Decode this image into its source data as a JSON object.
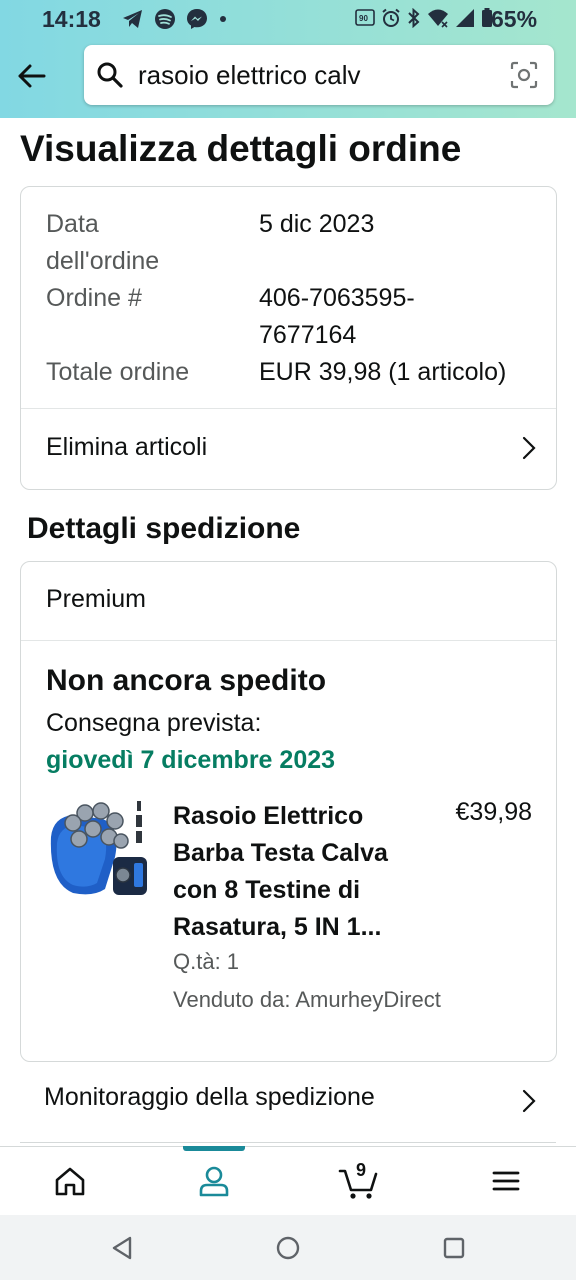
{
  "status_bar": {
    "time": "14:18",
    "battery": "65%",
    "left_icons": [
      "telegram-icon",
      "spotify-icon",
      "messenger-icon",
      "dot-icon"
    ],
    "right_icons": [
      "hd-voice-icon",
      "alarm-icon",
      "bluetooth-icon",
      "wifi-icon",
      "signal-icon",
      "battery-icon"
    ]
  },
  "search": {
    "query": "rasoio elettrico calv"
  },
  "page_title": "Visualizza dettagli ordine",
  "order_summary": {
    "date_label_line1": "Data",
    "date_label_line2": "dell'ordine",
    "date_value": "5 dic 2023",
    "order_label": "Ordine #",
    "order_value_line1": "406-7063595-",
    "order_value_line2": "7677164",
    "total_label": "Totale ordine",
    "total_value": "EUR 39,98 (1 articolo)",
    "delete_items_label": "Elimina articoli"
  },
  "shipping": {
    "section_title": "Dettagli spedizione",
    "shipping_type": "Premium",
    "status": "Non ancora spedito",
    "delivery_label": "Consegna prevista:",
    "delivery_date": "giovedì 7 dicembre 2023",
    "product": {
      "name": "Rasoio Elettrico Barba Testa Calva con 8 Testine di Rasatura, 5 IN 1...",
      "price": "€39,98",
      "quantity": "Q.tà: 1",
      "seller": "Venduto da: AmurheyDirect"
    },
    "tracking_label": "Monitoraggio della spedizione"
  },
  "bottom_nav": {
    "items": [
      "home-icon",
      "account-icon",
      "cart-icon",
      "menu-icon"
    ],
    "active": "account-icon",
    "cart_count": "9"
  },
  "colors": {
    "header_gradient_start": "#82d8e3",
    "header_gradient_end": "#a5e6ce",
    "delivery_green": "#067d62",
    "nav_indicator": "#1a8a99"
  }
}
